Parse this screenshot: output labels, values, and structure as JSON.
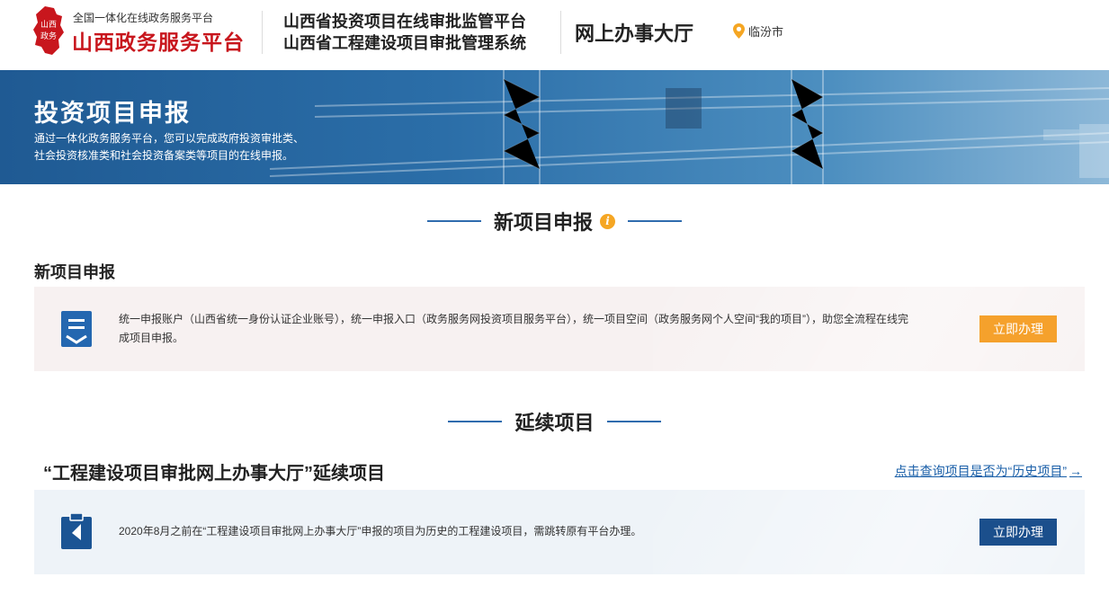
{
  "header": {
    "brand_sub": "全国一体化在线政务服务平台",
    "brand_main": "山西政务服务平台",
    "logo_text": "山西政务",
    "system_line1": "山西省投资项目在线审批监管平台",
    "system_line2": "山西省工程建设项目审批管理系统",
    "hall_title": "网上办事大厅",
    "location": "临汾市",
    "colors": {
      "brand_red": "#c8161d",
      "location_pin": "#f5a623"
    }
  },
  "banner": {
    "title": "投资项目申报",
    "desc_line1": "通过一体化政务服务平台，您可以完成政府投资审批类、",
    "desc_line2": "社会投资核准类和社会投资备案类等项目的在线申报。"
  },
  "section_new": {
    "heading": "新项目申报",
    "info_icon": "i",
    "subtitle": "新项目申报",
    "card_text": "统一申报账户（山西省统一身份认证企业账号），统一申报入口（政务服务网投资项目服务平台），统一项目空间（政务服务网个人空间“我的项目”），助您全流程在线完成项目申报。",
    "button": "立即办理",
    "icon": "document-list-icon"
  },
  "section_continue": {
    "heading": "延续项目",
    "subtitle": "“工程建设项目审批网上办事大厅”延续项目",
    "history_link": "点击查询项目是否为“历史项目”",
    "history_arrow": "→",
    "card_text": "2020年8月之前在“工程建设项目审批网上办事大厅”申报的项目为历史的工程建设项目，需跳转原有平台办理。",
    "button": "立即办理",
    "icon": "clipboard-icon"
  },
  "colors": {
    "accent_blue": "#2f6cae",
    "button_orange": "#f5a12c",
    "button_navy": "#1b4f8c",
    "link_blue": "#1a5fa8"
  }
}
